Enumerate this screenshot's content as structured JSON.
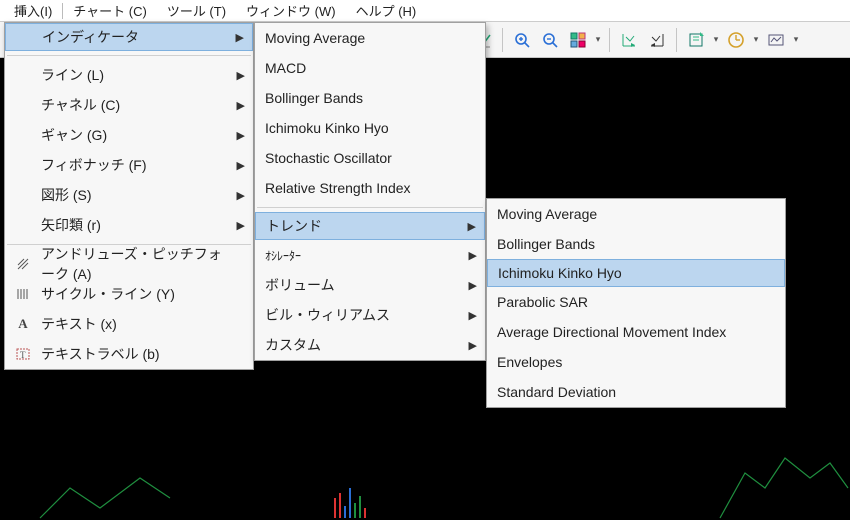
{
  "menubar": {
    "insert": "挿入(I)",
    "chart": "チャート (C)",
    "tools": "ツール (T)",
    "window": "ウィンドウ (W)",
    "help": "ヘルプ (H)"
  },
  "menu1": {
    "indicator": "インディケータ",
    "line": "ライン (L)",
    "channel": "チャネル (C)",
    "gann": "ギャン (G)",
    "fibonacci": "フィボナッチ (F)",
    "shapes": "図形 (S)",
    "arrows": "矢印類 (r)",
    "andrews": "アンドリューズ・ピッチフォーク (A)",
    "cycle": "サイクル・ライン (Y)",
    "text": "テキスト (x)",
    "textlabel": "テキストラベル (b)"
  },
  "menu2": {
    "ma": "Moving Average",
    "macd": "MACD",
    "bb": "Bollinger Bands",
    "ichimoku": "Ichimoku Kinko Hyo",
    "stoch": "Stochastic Oscillator",
    "rsi": "Relative Strength Index",
    "trend": "トレンド",
    "oscillator": "ｵｼﾚｰﾀｰ",
    "volume": "ボリューム",
    "billwilliams": "ビル・ウィリアムス",
    "custom": "カスタム"
  },
  "menu3": {
    "ma": "Moving Average",
    "bb": "Bollinger Bands",
    "ichimoku": "Ichimoku Kinko Hyo",
    "psar": "Parabolic SAR",
    "adx": "Average Directional Movement Index",
    "env": "Envelopes",
    "stddev": "Standard Deviation"
  }
}
